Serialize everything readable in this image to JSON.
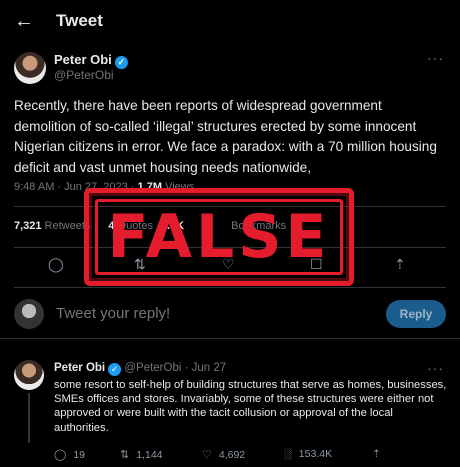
{
  "header": {
    "back_icon": "arrow-left-icon",
    "title": "Tweet"
  },
  "tweet": {
    "author_name": "Peter Obi",
    "author_handle": "@PeterObi",
    "text": "Recently, there have been reports of widespread government demolition of so-called ‘illegal’ structures erected by some innocent Nigerian citizens in error. We face a paradox: with a 70 million housing deficit and vast unmet housing needs nationwide,",
    "time": "9:48 AM · Jun 27, 2023 ·",
    "views_count": "1.7M",
    "views_label": "Views",
    "stats": {
      "retweets_count": "7,321",
      "retweets_label": "Retweets",
      "quotes_count": "4",
      "quotes_label": "Quotes",
      "likes_count": ".8K",
      "bookmarks_label": "Bookmarks"
    }
  },
  "reply_box": {
    "placeholder": "Tweet your reply!",
    "button_label": "Reply"
  },
  "stamp": {
    "label": "FALSE",
    "color": "#e41c2c"
  },
  "reply_tweet": {
    "author_name": "Peter Obi",
    "author_handle": "@PeterObi",
    "date": "· Jun 27",
    "text": "some resort to self-help of building structures that serve as homes, businesses, SMEs offices and stores.  Invariably, some of these structures were either not approved or were built with the tacit collusion or approval of the local authorities.",
    "replies": "19",
    "retweets": "1,144",
    "likes": "4,692",
    "views": "153.4K"
  },
  "colors": {
    "background": "#000000",
    "accent": "#1d9bf0",
    "muted": "#71767b"
  }
}
